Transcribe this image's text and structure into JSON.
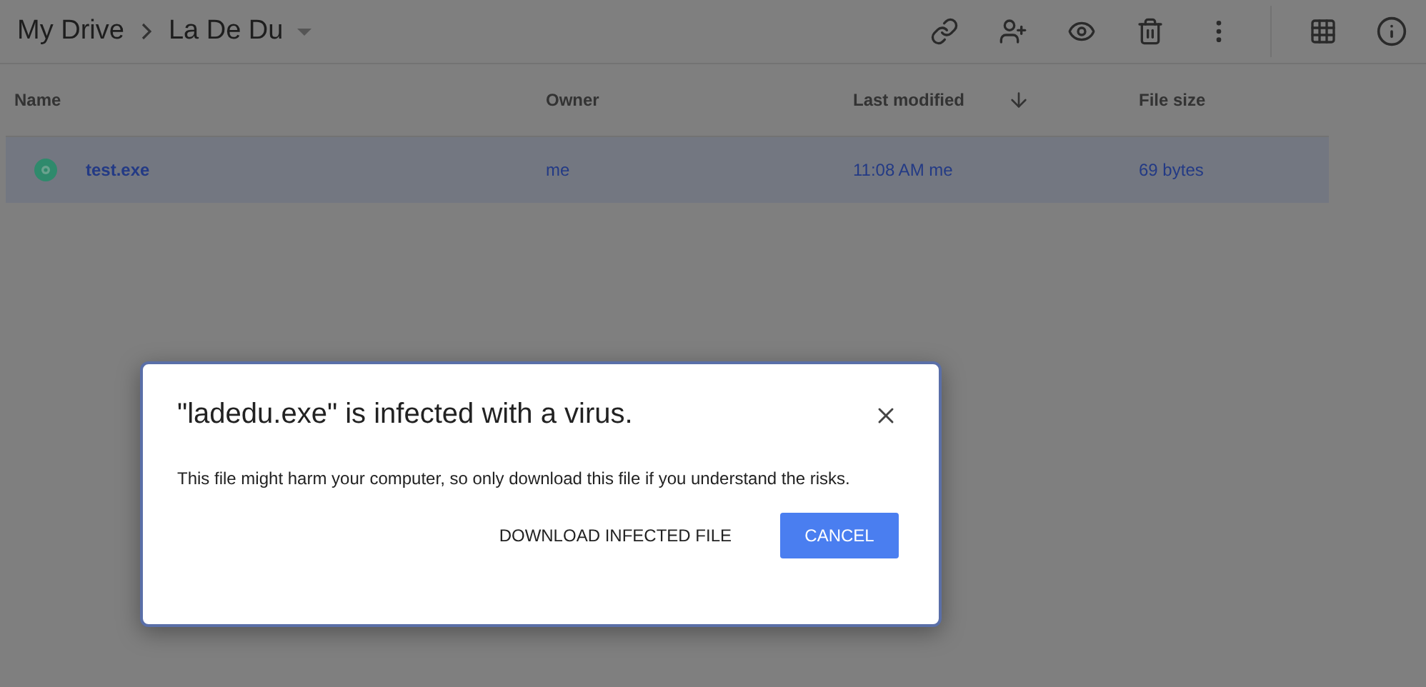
{
  "breadcrumb": {
    "root": "My Drive",
    "current": "La De Du"
  },
  "table": {
    "columns": [
      {
        "label": "Name",
        "sorted": false
      },
      {
        "label": "Owner",
        "sorted": false
      },
      {
        "label": "Last modified",
        "sorted": true
      },
      {
        "label": "File size",
        "sorted": false
      }
    ],
    "rows": [
      {
        "name": "test.exe",
        "owner": "me",
        "modified": "11:08 AM",
        "modified_by": "me",
        "size": "69 bytes",
        "selected": true
      }
    ]
  },
  "dialog": {
    "title": "\"ladedu.exe\" is infected with a virus.",
    "message": "This file might harm your computer, so only download this file if you understand the risks.",
    "buttons": [
      {
        "label": "DOWNLOAD INFECTED FILE",
        "kind": "text"
      },
      {
        "label": "CANCEL",
        "kind": "primary"
      }
    ]
  }
}
